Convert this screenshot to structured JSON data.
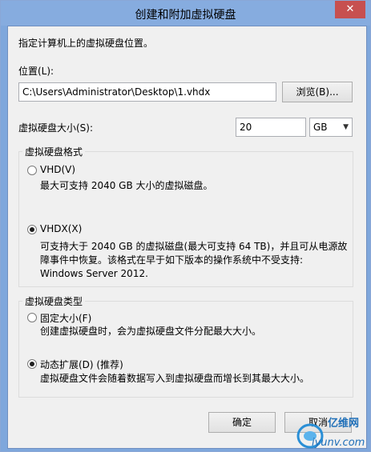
{
  "window": {
    "title": "创建和附加虚拟硬盘",
    "close_glyph": "✕"
  },
  "intro": "指定计算机上的虚拟硬盘位置。",
  "location": {
    "label": "位置(L):",
    "value": "C:\\Users\\Administrator\\Desktop\\1.vhdx",
    "browse_label": "浏览(B)..."
  },
  "size": {
    "label": "虚拟硬盘大小(S):",
    "value": "20",
    "unit": "GB",
    "unit_arrow": "▼"
  },
  "format_group": {
    "title": "虚拟硬盘格式",
    "options": [
      {
        "label": "VHD(V)",
        "checked": false,
        "description": "最大可支持 2040 GB 大小的虚拟磁盘。"
      },
      {
        "label": "VHDX(X)",
        "checked": true,
        "description_lines": [
          "可支持大于 2040 GB 的虚拟磁盘(最大可支持 64 TB)，并且可从电源故",
          "障事件中恢复。该格式在早于如下版本的操作系统中不受支持:",
          "Windows Server 2012."
        ]
      }
    ]
  },
  "type_group": {
    "title": "虚拟硬盘类型",
    "options": [
      {
        "label": "固定大小(F)",
        "checked": false,
        "description": "创建虚拟硬盘时，会为虚拟硬盘文件分配最大大小。"
      },
      {
        "label": "动态扩展(D) (推荐)",
        "checked": true,
        "description": "虚拟硬盘文件会随着数据写入到虚拟硬盘而增长到其最大大小。"
      }
    ]
  },
  "buttons": {
    "ok": "确定",
    "cancel": "取消"
  },
  "watermark": {
    "brand": "亿维网",
    "url": "iyunv.com"
  },
  "colors": {
    "titlebar": "#86acdf",
    "close": "#c75050"
  }
}
